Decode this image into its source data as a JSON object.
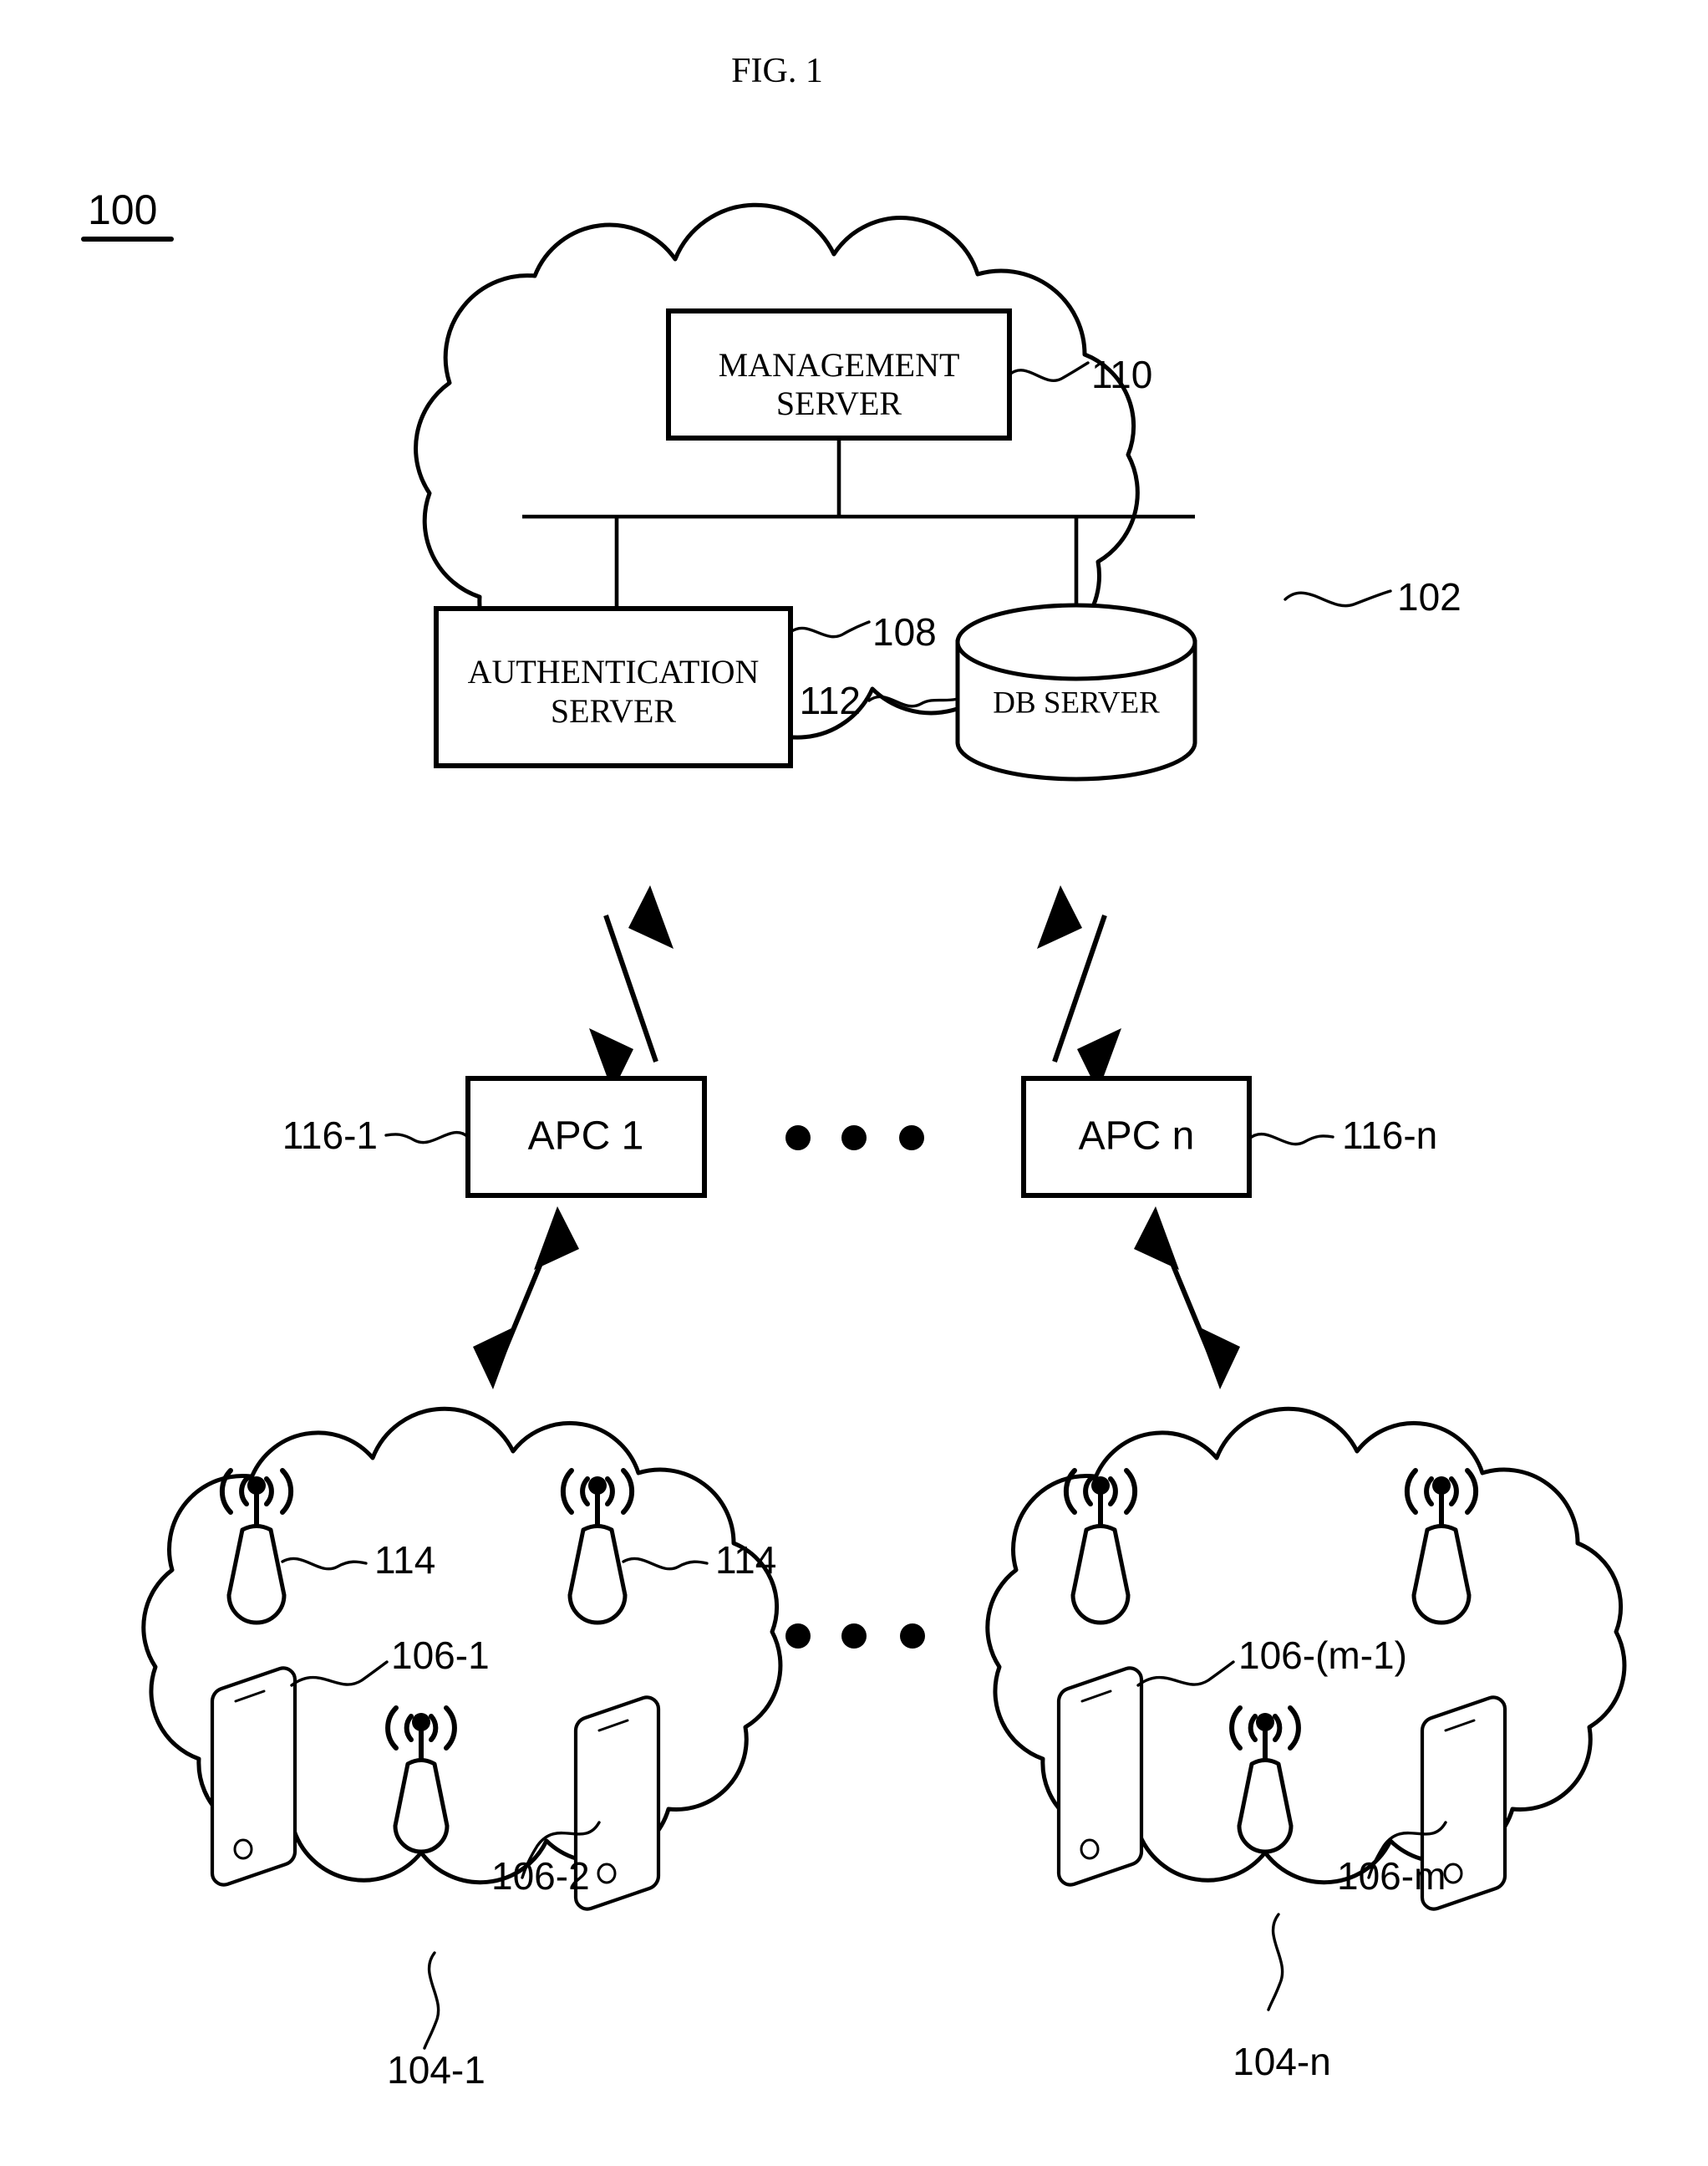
{
  "figure": {
    "title": "FIG. 1",
    "system_ref": "100"
  },
  "network_cloud": {
    "ref": "102",
    "nodes": {
      "management_server": {
        "label_line1": "MANAGEMENT",
        "label_line2": "SERVER",
        "ref": "110"
      },
      "authentication_server": {
        "label_line1": "AUTHENTICATION",
        "label_line2": "SERVER",
        "ref": "108"
      },
      "db_server": {
        "label": "DB SERVER",
        "ref": "112"
      }
    }
  },
  "controllers": {
    "ellipsis": "• • •",
    "items": [
      {
        "label": "APC 1",
        "ref": "116-1"
      },
      {
        "label": "APC n",
        "ref": "116-n"
      }
    ]
  },
  "access_clouds": {
    "ellipsis": "• • •",
    "left": {
      "ref": "104-1",
      "access_points": [
        {
          "ref": "114"
        },
        {
          "ref": "114"
        },
        {
          "ref": ""
        }
      ],
      "terminals": [
        {
          "ref": "106-1"
        },
        {
          "ref": "106-2"
        }
      ]
    },
    "right": {
      "ref": "104-n",
      "access_points": [
        {
          "ref": ""
        },
        {
          "ref": ""
        },
        {
          "ref": ""
        }
      ],
      "terminals": [
        {
          "ref": "106-(m-1)"
        },
        {
          "ref": "106-m"
        }
      ]
    }
  },
  "colors": {
    "ink": "#000000",
    "paper": "#ffffff"
  }
}
